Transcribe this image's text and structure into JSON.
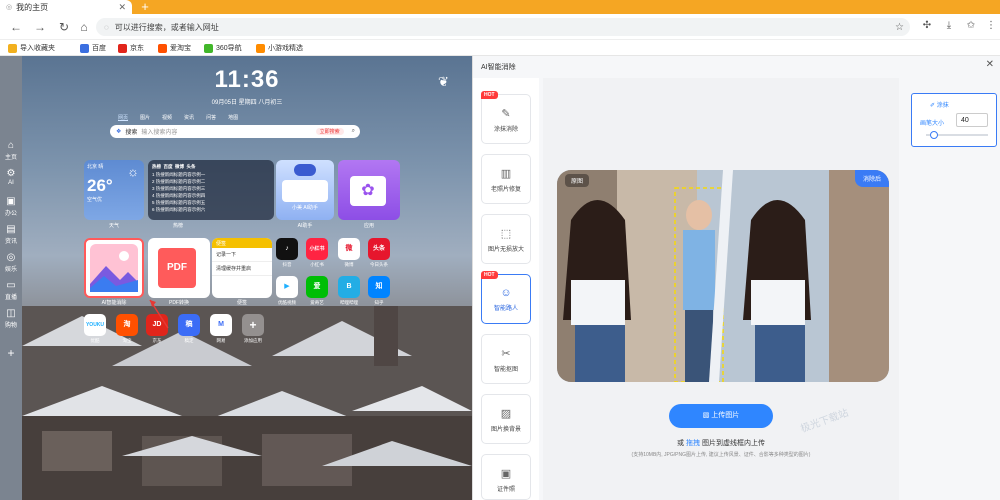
{
  "browser": {
    "tab_title": "我的主页",
    "new_tab": "+",
    "address_placeholder": "可以进行搜索，或者输入网址",
    "bookmarks": [
      {
        "label": "导入收藏夹",
        "color": "#f2b01e"
      },
      {
        "label": "百度",
        "color": "#3b6fe0"
      },
      {
        "label": "京东",
        "color": "#e1251b"
      },
      {
        "label": "爱淘宝",
        "color": "#ff5000"
      },
      {
        "label": "360导航",
        "color": "#42b72a"
      },
      {
        "label": "小游戏精选",
        "color": "#ff8c00"
      }
    ]
  },
  "sidebar": {
    "items": [
      {
        "label": "主页",
        "icon": "home-icon"
      },
      {
        "label": "AI",
        "icon": "ai-icon"
      },
      {
        "label": "办公",
        "icon": "briefcase-icon"
      },
      {
        "label": "资讯",
        "icon": "book-icon"
      },
      {
        "label": "娱乐",
        "icon": "game-icon"
      },
      {
        "label": "直播",
        "icon": "tv-icon"
      },
      {
        "label": "购物",
        "icon": "bag-icon"
      }
    ],
    "add": "+"
  },
  "home": {
    "time": "11:36",
    "date": "09月05日 星期四 八月初三",
    "search_tabs": [
      "网页",
      "图片",
      "视频",
      "资讯",
      "问答",
      "地图"
    ],
    "search_engine": "搜索",
    "search_placeholder": "输入搜索内容",
    "search_pill": "立即搜索",
    "weather": {
      "city": "北京 晴",
      "temp": "26°",
      "detail": "空气优",
      "caption": "天气"
    },
    "hot": {
      "tabs": [
        "热榜",
        "百度",
        "微博",
        "头条"
      ],
      "items": [
        "1 热搜新闻标题内容示例一",
        "2 热搜新闻标题内容示例二",
        "3 热搜新闻标题内容示例三",
        "4 热搜新闻标题内容示例四",
        "5 热搜新闻标题内容示例五",
        "6 热搜新闻标题内容示例六"
      ],
      "caption": "热榜"
    },
    "ai_card": {
      "text": "小美 AI助手",
      "caption": "AI助手"
    },
    "purple_caption": "应用",
    "tiles": [
      {
        "label": "AI智能消除",
        "caption": "AI智能消除"
      },
      {
        "label": "PDF",
        "caption": "PDF转换"
      },
      {
        "label": "便签",
        "caption": "便签"
      }
    ],
    "note": {
      "title": "便签",
      "rows": [
        "记录一下",
        "清理缓存并重启"
      ]
    },
    "apps": [
      {
        "label": "抖音",
        "text": "♪",
        "color": "#111111"
      },
      {
        "label": "小红书",
        "text": "小红书",
        "color": "#ff2442"
      },
      {
        "label": "微博",
        "text": "微",
        "color": "#e6162d"
      },
      {
        "label": "今日头条",
        "text": "头条",
        "color": "#e6162d"
      },
      {
        "label": "优酷视频",
        "text": "▶",
        "color": "#1fb0ff"
      },
      {
        "label": "爱奇艺",
        "text": "爱",
        "color": "#00be06"
      },
      {
        "label": "哔哩哔哩",
        "text": "B",
        "color": "#23ade5"
      },
      {
        "label": "知乎",
        "text": "知",
        "color": "#0084ff"
      },
      {
        "label": "优酷",
        "text": "YOUKU",
        "color": "#ffffff"
      },
      {
        "label": "淘宝",
        "text": "淘",
        "color": "#ff5000"
      },
      {
        "label": "京东",
        "text": "JD",
        "color": "#e1251b"
      },
      {
        "label": "稿定",
        "text": "稿",
        "color": "#3b6cf6"
      },
      {
        "label": "网易",
        "text": "M",
        "color": "#ffffff"
      },
      {
        "label": "添加应用",
        "text": "+",
        "color": "#9aa1a8"
      }
    ]
  },
  "panel": {
    "title": "AI智能消除",
    "close": "✕",
    "tools": [
      {
        "label": "涂抹消除",
        "icon": "brush-icon",
        "hot": true,
        "active": false
      },
      {
        "label": "老照片修复",
        "icon": "photo-icon",
        "hot": false,
        "active": false
      },
      {
        "label": "图片无损放大",
        "icon": "enlarge-icon",
        "hot": false,
        "active": false
      },
      {
        "label": "智能路人",
        "icon": "person-icon",
        "hot": true,
        "active": true
      },
      {
        "label": "智能抠图",
        "icon": "cutout-icon",
        "hot": false,
        "active": false
      },
      {
        "label": "图片换背景",
        "icon": "background-icon",
        "hot": false,
        "active": false
      },
      {
        "label": "证件照",
        "icon": "idphoto-icon",
        "hot": false,
        "active": false
      }
    ],
    "hot_badge": "HOT",
    "compare_before": "原图",
    "compare_after": "消除后",
    "upload_label": "上传图片",
    "drag_tip_prefix": "或",
    "drag_tip_link": "拖拽",
    "drag_tip_suffix": "图片到虚线框内上传",
    "format_tip": "(支持10MB内, JPG/PNG图片上传, 建议上传风景、证件、合影等多种类型的图片)",
    "watermark": "极光下载站",
    "brush": {
      "mode": "涂抹",
      "size_label": "画笔大小",
      "size_value": "40"
    }
  }
}
